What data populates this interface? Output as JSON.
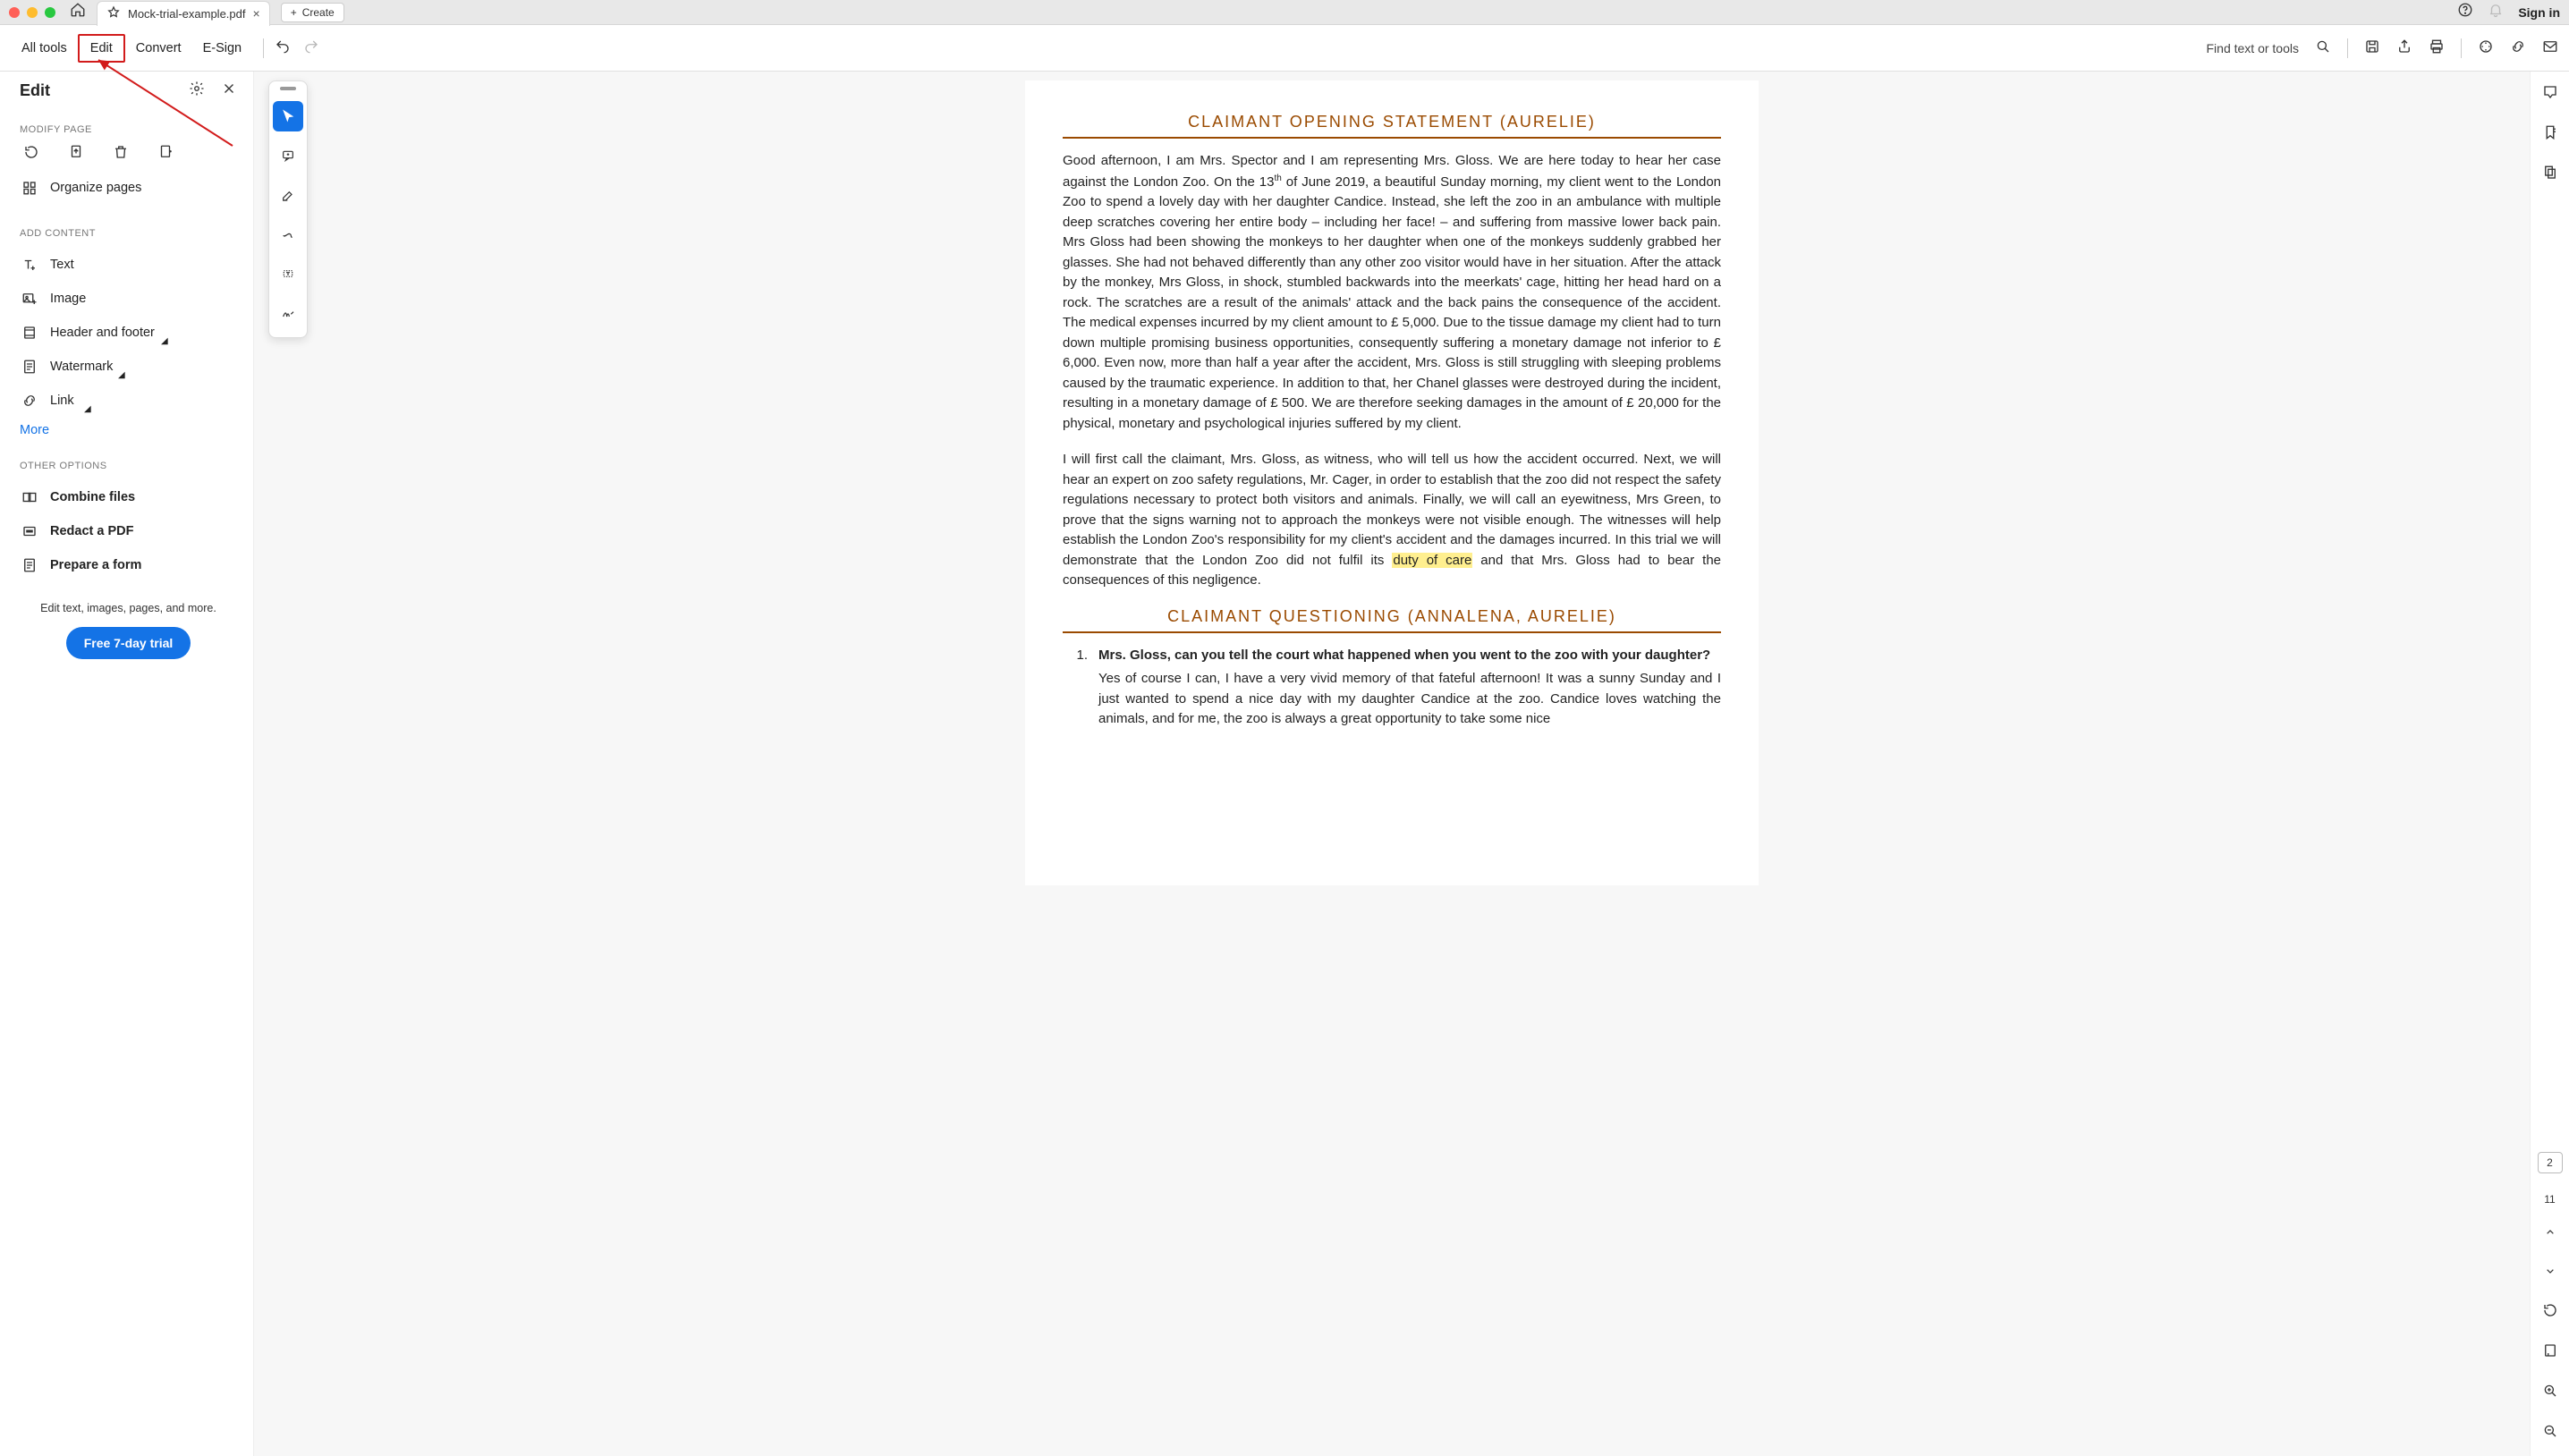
{
  "chrome": {
    "tab_title": "Mock-trial-example.pdf",
    "create_label": "Create",
    "sign_in": "Sign in"
  },
  "toolbar": {
    "all_tools": "All tools",
    "edit": "Edit",
    "convert": "Convert",
    "esign": "E-Sign",
    "find": "Find text or tools"
  },
  "panel": {
    "title": "Edit",
    "modify_page": "MODIFY PAGE",
    "organize": "Organize pages",
    "add_content": "ADD CONTENT",
    "text": "Text",
    "image": "Image",
    "header_footer": "Header and footer",
    "watermark": "Watermark",
    "link": "Link",
    "more": "More",
    "other_options": "OTHER OPTIONS",
    "combine": "Combine files",
    "redact": "Redact a PDF",
    "prepare": "Prepare a form",
    "promo_text": "Edit text, images, pages, and more.",
    "promo_btn": "Free 7-day trial"
  },
  "doc": {
    "h1": "CLAIMANT OPENING STATEMENT (AURELIE)",
    "p1a": "Good afternoon, I am Mrs. Spector and I am representing Mrs. Gloss. We are here today to hear her case against the London Zoo. On the 13",
    "p1th": "th",
    "p1b": " of June 2019, a beautiful Sunday morning, my client went to the London Zoo to spend a lovely day with her daughter Candice. Instead, she left the zoo in an ambulance with multiple deep scratches covering her entire body – including her face! – and suffering from massive lower back pain. Mrs Gloss had been showing the monkeys to her daughter when one of the monkeys suddenly grabbed her glasses. She had not behaved differently than any other zoo visitor would have in her situation. After the attack by the monkey, Mrs Gloss, in shock, stumbled backwards into the meerkats' cage, hitting her head hard on a rock. The scratches are a result of the animals' attack and the back pains the consequence of the accident. The medical expenses incurred by my client amount to £ 5,000. Due to the tissue damage my client had to turn down multiple promising business opportunities, consequently suffering a monetary damage not inferior to £ 6,000. Even now, more than half a year after the accident, Mrs. Gloss is still struggling with sleeping problems caused by the traumatic experience. In addition to that, her Chanel glasses were destroyed during the incident, resulting in a monetary damage of £ 500. We are therefore seeking damages in the amount of £ 20,000 for the physical, monetary and psychological injuries suffered by my client.",
    "p2a": "I will first call the claimant, Mrs. Gloss, as witness, who will tell us how the accident occurred. Next, we will hear an expert on zoo safety regulations, Mr. Cager, in order to establish that the zoo did not respect the safety regulations necessary to protect both visitors and animals. Finally, we will call an eyewitness, Mrs Green, to prove that the signs warning not to approach the monkeys were not visible enough. The witnesses will help establish the London Zoo's responsibility for my client's accident and the damages incurred. In this trial we will demonstrate that the London Zoo did not fulfil its ",
    "p2hl": "duty of care",
    "p2b": " and that Mrs. Gloss had to bear the consequences of this negligence.",
    "h2": "CLAIMANT QUESTIONING (ANNALENA, AURELIE)",
    "q1_num": "1.",
    "q1_q": "Mrs. Gloss, can you tell the court what happened when you went to the zoo with your daughter?",
    "q1_a": "Yes of course I can, I have a very vivid memory of that fateful afternoon! It was a sunny Sunday and I just wanted to spend a nice day with my daughter Candice at the zoo. Candice loves watching the animals, and for me, the zoo is always a great opportunity to take some nice"
  },
  "nav": {
    "current_page": "2",
    "total_pages": "11"
  }
}
